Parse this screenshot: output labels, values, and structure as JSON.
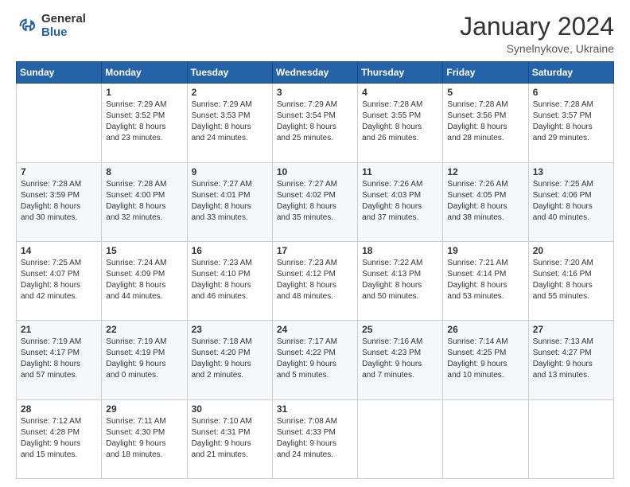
{
  "header": {
    "logo_general": "General",
    "logo_blue": "Blue",
    "month": "January 2024",
    "location": "Synelnykove, Ukraine"
  },
  "weekdays": [
    "Sunday",
    "Monday",
    "Tuesday",
    "Wednesday",
    "Thursday",
    "Friday",
    "Saturday"
  ],
  "weeks": [
    [
      {
        "day": "",
        "info": ""
      },
      {
        "day": "1",
        "info": "Sunrise: 7:29 AM\nSunset: 3:52 PM\nDaylight: 8 hours\nand 23 minutes."
      },
      {
        "day": "2",
        "info": "Sunrise: 7:29 AM\nSunset: 3:53 PM\nDaylight: 8 hours\nand 24 minutes."
      },
      {
        "day": "3",
        "info": "Sunrise: 7:29 AM\nSunset: 3:54 PM\nDaylight: 8 hours\nand 25 minutes."
      },
      {
        "day": "4",
        "info": "Sunrise: 7:28 AM\nSunset: 3:55 PM\nDaylight: 8 hours\nand 26 minutes."
      },
      {
        "day": "5",
        "info": "Sunrise: 7:28 AM\nSunset: 3:56 PM\nDaylight: 8 hours\nand 28 minutes."
      },
      {
        "day": "6",
        "info": "Sunrise: 7:28 AM\nSunset: 3:57 PM\nDaylight: 8 hours\nand 29 minutes."
      }
    ],
    [
      {
        "day": "7",
        "info": "Sunrise: 7:28 AM\nSunset: 3:59 PM\nDaylight: 8 hours\nand 30 minutes."
      },
      {
        "day": "8",
        "info": "Sunrise: 7:28 AM\nSunset: 4:00 PM\nDaylight: 8 hours\nand 32 minutes."
      },
      {
        "day": "9",
        "info": "Sunrise: 7:27 AM\nSunset: 4:01 PM\nDaylight: 8 hours\nand 33 minutes."
      },
      {
        "day": "10",
        "info": "Sunrise: 7:27 AM\nSunset: 4:02 PM\nDaylight: 8 hours\nand 35 minutes."
      },
      {
        "day": "11",
        "info": "Sunrise: 7:26 AM\nSunset: 4:03 PM\nDaylight: 8 hours\nand 37 minutes."
      },
      {
        "day": "12",
        "info": "Sunrise: 7:26 AM\nSunset: 4:05 PM\nDaylight: 8 hours\nand 38 minutes."
      },
      {
        "day": "13",
        "info": "Sunrise: 7:25 AM\nSunset: 4:06 PM\nDaylight: 8 hours\nand 40 minutes."
      }
    ],
    [
      {
        "day": "14",
        "info": "Sunrise: 7:25 AM\nSunset: 4:07 PM\nDaylight: 8 hours\nand 42 minutes."
      },
      {
        "day": "15",
        "info": "Sunrise: 7:24 AM\nSunset: 4:09 PM\nDaylight: 8 hours\nand 44 minutes."
      },
      {
        "day": "16",
        "info": "Sunrise: 7:23 AM\nSunset: 4:10 PM\nDaylight: 8 hours\nand 46 minutes."
      },
      {
        "day": "17",
        "info": "Sunrise: 7:23 AM\nSunset: 4:12 PM\nDaylight: 8 hours\nand 48 minutes."
      },
      {
        "day": "18",
        "info": "Sunrise: 7:22 AM\nSunset: 4:13 PM\nDaylight: 8 hours\nand 50 minutes."
      },
      {
        "day": "19",
        "info": "Sunrise: 7:21 AM\nSunset: 4:14 PM\nDaylight: 8 hours\nand 53 minutes."
      },
      {
        "day": "20",
        "info": "Sunrise: 7:20 AM\nSunset: 4:16 PM\nDaylight: 8 hours\nand 55 minutes."
      }
    ],
    [
      {
        "day": "21",
        "info": "Sunrise: 7:19 AM\nSunset: 4:17 PM\nDaylight: 8 hours\nand 57 minutes."
      },
      {
        "day": "22",
        "info": "Sunrise: 7:19 AM\nSunset: 4:19 PM\nDaylight: 9 hours\nand 0 minutes."
      },
      {
        "day": "23",
        "info": "Sunrise: 7:18 AM\nSunset: 4:20 PM\nDaylight: 9 hours\nand 2 minutes."
      },
      {
        "day": "24",
        "info": "Sunrise: 7:17 AM\nSunset: 4:22 PM\nDaylight: 9 hours\nand 5 minutes."
      },
      {
        "day": "25",
        "info": "Sunrise: 7:16 AM\nSunset: 4:23 PM\nDaylight: 9 hours\nand 7 minutes."
      },
      {
        "day": "26",
        "info": "Sunrise: 7:14 AM\nSunset: 4:25 PM\nDaylight: 9 hours\nand 10 minutes."
      },
      {
        "day": "27",
        "info": "Sunrise: 7:13 AM\nSunset: 4:27 PM\nDaylight: 9 hours\nand 13 minutes."
      }
    ],
    [
      {
        "day": "28",
        "info": "Sunrise: 7:12 AM\nSunset: 4:28 PM\nDaylight: 9 hours\nand 15 minutes."
      },
      {
        "day": "29",
        "info": "Sunrise: 7:11 AM\nSunset: 4:30 PM\nDaylight: 9 hours\nand 18 minutes."
      },
      {
        "day": "30",
        "info": "Sunrise: 7:10 AM\nSunset: 4:31 PM\nDaylight: 9 hours\nand 21 minutes."
      },
      {
        "day": "31",
        "info": "Sunrise: 7:08 AM\nSunset: 4:33 PM\nDaylight: 9 hours\nand 24 minutes."
      },
      {
        "day": "",
        "info": ""
      },
      {
        "day": "",
        "info": ""
      },
      {
        "day": "",
        "info": ""
      }
    ]
  ]
}
